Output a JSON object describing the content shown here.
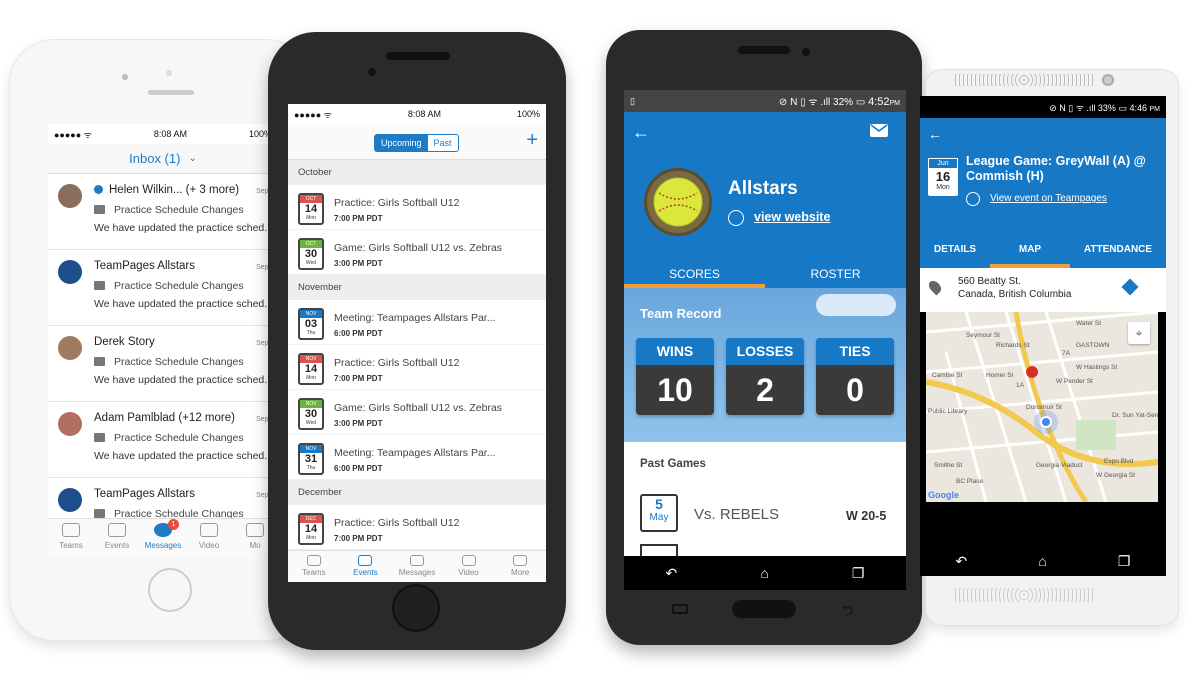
{
  "phone1": {
    "status": {
      "carrier": "●●●●● ᯤ",
      "time": "8:08 AM",
      "battery": "100%"
    },
    "inbox_title": "Inbox (1)",
    "messages": [
      {
        "name": "Helen Wilkin...  (+ 3 more)",
        "subject": "Practice Schedule Changes",
        "preview": "We have updated the practice sched...",
        "date": "Sept",
        "unread": true
      },
      {
        "name": "TeamPages Allstars",
        "subject": "Practice Schedule Changes",
        "preview": "We have updated the practice sched...",
        "date": "Sept"
      },
      {
        "name": "Derek Story",
        "subject": "Practice Schedule Changes",
        "preview": "We have updated the practice sched...",
        "date": "Sept"
      },
      {
        "name": "Adam Pamlblad (+12 more)",
        "subject": "Practice Schedule Changes",
        "preview": "We have updated the practice sched...",
        "date": "Sept"
      },
      {
        "name": "TeamPages Allstars",
        "subject": "Practice Schedule Changes",
        "preview": "We have updated the practice sched...",
        "date": "Sept"
      }
    ],
    "tabs": [
      "Teams",
      "Events",
      "Messages",
      "Video",
      "Mo"
    ],
    "badge": "1"
  },
  "phone2": {
    "status": {
      "carrier": "●●●●● ᯤ",
      "time": "8:08 AM",
      "battery": "100%"
    },
    "segment": {
      "upcoming": "Upcoming",
      "past": "Past"
    },
    "plus": "+",
    "sections": [
      {
        "label": "October",
        "events": [
          {
            "mon": "OCT",
            "day": "14",
            "dow": "Mon",
            "title": "Practice: Girls Softball U12",
            "time": "7:00 PM PDT",
            "color": "#d9534f"
          },
          {
            "mon": "OCT",
            "day": "30",
            "dow": "Wed",
            "title": "Game: Girls Softball U12 vs. Zebras",
            "time": "3:00 PM PDT",
            "color": "#6cb33f"
          }
        ]
      },
      {
        "label": "November",
        "events": [
          {
            "mon": "NOV",
            "day": "03",
            "dow": "Thu",
            "title": "Meeting: Teampages Allstars Par...",
            "time": "6:00 PM PDT",
            "color": "#1778c6"
          },
          {
            "mon": "NOV",
            "day": "14",
            "dow": "Mon",
            "title": "Practice: Girls Softball U12",
            "time": "7:00 PM PDT",
            "color": "#d9534f"
          },
          {
            "mon": "NOV",
            "day": "30",
            "dow": "Wed",
            "title": "Game: Girls Softball U12 vs. Zebras",
            "time": "3:00 PM PDT",
            "color": "#6cb33f"
          },
          {
            "mon": "NOV",
            "day": "31",
            "dow": "Thu",
            "title": "Meeting: Teampages Allstars Par...",
            "time": "6:00 PM PDT",
            "color": "#1778c6"
          }
        ]
      },
      {
        "label": "December",
        "events": [
          {
            "mon": "DEC",
            "day": "14",
            "dow": "Mon",
            "title": "Practice: Girls Softball U12",
            "time": "7:00 PM PDT",
            "color": "#d9534f"
          }
        ]
      }
    ],
    "tabs": [
      "Teams",
      "Events",
      "Messages",
      "Video",
      "More"
    ]
  },
  "phone3": {
    "status": {
      "time": "4:52",
      "ampm": "PM",
      "battery": "32%"
    },
    "team": "Allstars",
    "website": "view website",
    "tabs": [
      "SCORES",
      "ROSTER"
    ],
    "record_title": "Team Record",
    "record": [
      {
        "label": "WINS",
        "value": "10"
      },
      {
        "label": "LOSSES",
        "value": "2"
      },
      {
        "label": "TIES",
        "value": "0"
      }
    ],
    "past_title": "Past Games",
    "game": {
      "day": "5",
      "month": "May",
      "opponent": "Vs. REBELS",
      "result": "W 20-5"
    }
  },
  "phone4": {
    "status": {
      "time": "4:46",
      "ampm": "PM",
      "battery": "33%"
    },
    "date": {
      "mon": "Jun",
      "day": "16",
      "dow": "Mon"
    },
    "title": "League Game: GreyWall (A) @ Commish (H)",
    "link": "View event on Teampages",
    "tabs": [
      "DETAILS",
      "MAP",
      "ATTENDANCE"
    ],
    "address1": "560 Beatty St.",
    "address2": "Canada, British Columbia",
    "map_labels": [
      "Water St",
      "GASTOWN",
      "W Hastings St",
      "W Pender St",
      "Dunsmuir St",
      "Public Library",
      "Dr. Sun Yat-Sen Classical",
      "Expo Blvd",
      "W Georgia St",
      "Georgia Viaduct",
      "BC Place",
      "Google",
      "Seymour St",
      "Richards St",
      "Cambie St",
      "Homer St",
      "Smithe St",
      "7A",
      "1A"
    ]
  }
}
